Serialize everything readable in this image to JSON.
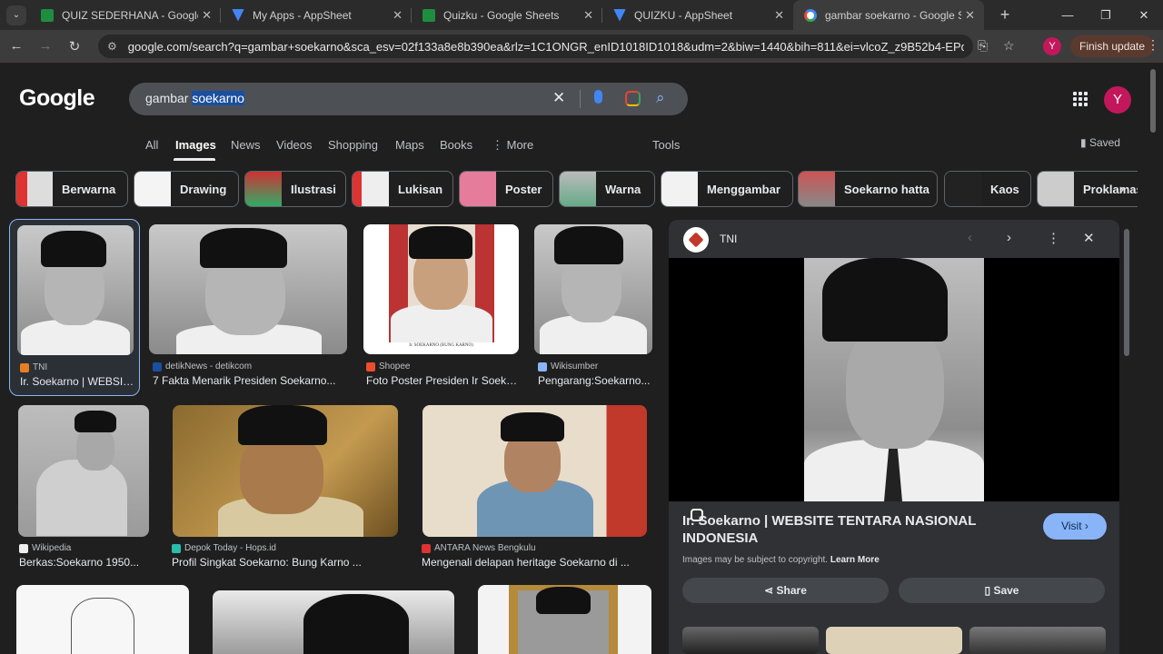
{
  "tabs": [
    {
      "title": "QUIZ SEDERHANA - Google Sheets",
      "icon": "sheets-icon"
    },
    {
      "title": "My Apps - AppSheet",
      "icon": "appsheet-icon"
    },
    {
      "title": "Quizku - Google Sheets",
      "icon": "sheets-icon"
    },
    {
      "title": "QUIZKU - AppSheet",
      "icon": "appsheet-icon"
    },
    {
      "title": "gambar soekarno - Google Search",
      "icon": "google-icon"
    }
  ],
  "addressbar": {
    "url": "google.com/search?q=gambar+soekarno&sca_esv=02f133a8e8b390ea&rlz=1C1ONGR_enID1018ID1018&udm=2&biw=1440&bih=811&ei=vlcoZ_z9B52b4-EPqlOD-A...",
    "profile_initial": "Y",
    "finish_update": "Finish update"
  },
  "google": {
    "logo": "Google",
    "query_plain": "gambar ",
    "query_selected": "soekarno",
    "avatar_initial": "Y"
  },
  "nav": {
    "all": "All",
    "images": "Images",
    "news": "News",
    "videos": "Videos",
    "shopping": "Shopping",
    "maps": "Maps",
    "books": "Books",
    "more": "⋮  More",
    "tools": "Tools",
    "saved": "Saved"
  },
  "chips": [
    "Berwarna",
    "Drawing",
    "Ilustrasi",
    "Lukisan",
    "Poster",
    "Warna",
    "Menggambar",
    "Soekarno hatta",
    "Kaos",
    "Proklamasi"
  ],
  "results": [
    {
      "source": "TNI",
      "caption": "Ir. Soekarno | WEBSITE TENTARA NASIONAL INDONESIA"
    },
    {
      "source": "detikNews - detikcom",
      "caption": "7 Fakta Menarik Presiden Soekarno..."
    },
    {
      "source": "Shopee",
      "caption": "Foto Poster Presiden Ir Soekarno..."
    },
    {
      "source": "Wikisumber",
      "caption": "Pengarang:Soekarno..."
    },
    {
      "source": "Wikipedia",
      "caption": "Berkas:Soekarno 1950..."
    },
    {
      "source": "Depok Today - Hops.id",
      "caption": "Profil Singkat Soekarno: Bung Karno ..."
    },
    {
      "source": "ANTARA News Bengkulu",
      "caption": "Mengenali delapan heritage Soekarno di ..."
    }
  ],
  "poster_caption": "Ir. SOEKARNO (BUNG KARNO)",
  "panel": {
    "source": "TNI",
    "title": "Ir. Soekarno | WEBSITE TENTARA NASIONAL INDONESIA",
    "visit": "Visit  ›",
    "copyright": "Images may be subject to copyright.",
    "learn_more": "Learn More",
    "share": "Share",
    "save": "Save"
  }
}
